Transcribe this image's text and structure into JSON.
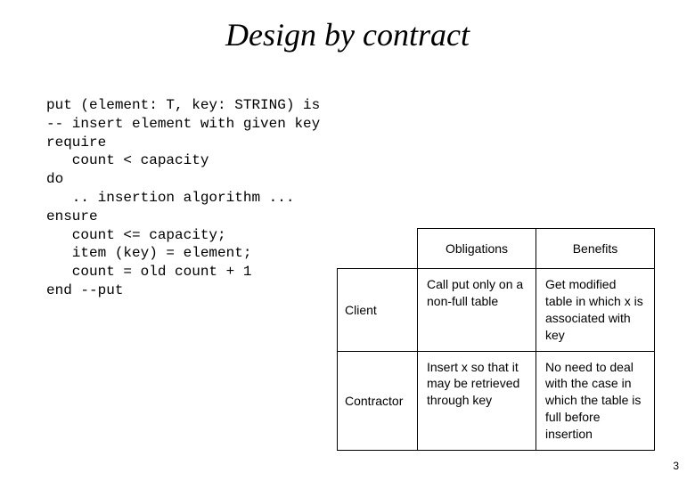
{
  "title": "Design by contract",
  "code": "put (element: T, key: STRING) is\n-- insert element with given key\nrequire\n   count < capacity\ndo\n   .. insertion algorithm ...\nensure\n   count <= capacity;\n   item (key) = element;\n   count = old count + 1\nend --put",
  "table": {
    "headers": {
      "col1": "Obligations",
      "col2": "Benefits"
    },
    "rows": [
      {
        "label": "Client",
        "obligations": "Call put only on a non-full table",
        "benefits": "Get modified table in which x is associated with key"
      },
      {
        "label": "Contractor",
        "obligations": "Insert x so that it may be retrieved through key",
        "benefits": "No need to deal with the case in which the table is full before insertion"
      }
    ]
  },
  "page_number": "3"
}
